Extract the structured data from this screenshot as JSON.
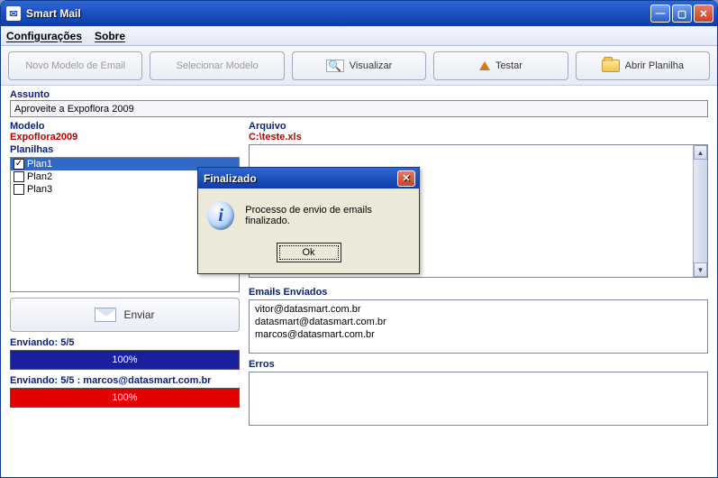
{
  "window": {
    "title": "Smart Mail"
  },
  "menu": {
    "config": "Configurações",
    "about": "Sobre"
  },
  "toolbar": {
    "novo": "Novo Modelo de Email",
    "selecionar": "Selecionar Modelo",
    "visualizar": "Visualizar",
    "testar": "Testar",
    "abrir": "Abrir Planilha"
  },
  "labels": {
    "assunto": "Assunto",
    "modelo": "Modelo",
    "planilhas": "Planilhas",
    "arquivo": "Arquivo",
    "emails_enviados": "Emails Enviados",
    "erros": "Erros"
  },
  "assunto_value": "Aproveite a Expoflora 2009",
  "modelo_value": "Expoflora2009",
  "arquivo_value": "C:\\teste.xls",
  "planilhas": [
    {
      "name": "Plan1",
      "checked": true,
      "selected": true
    },
    {
      "name": "Plan2",
      "checked": false,
      "selected": false
    },
    {
      "name": "Plan3",
      "checked": false,
      "selected": false
    }
  ],
  "enviar_label": "Enviar",
  "emails_enviados": [
    "vitor@datasmart.com.br",
    "datasmart@datasmart.com.br",
    "marcos@datasmart.com.br"
  ],
  "progress1": {
    "label": "Enviando: 5/5",
    "text": "100%"
  },
  "progress2": {
    "label": "Enviando: 5/5 : marcos@datasmart.com.br",
    "text": "100%"
  },
  "dialog": {
    "title": "Finalizado",
    "message": "Processo de envio de emails finalizado.",
    "ok": "Ok"
  }
}
